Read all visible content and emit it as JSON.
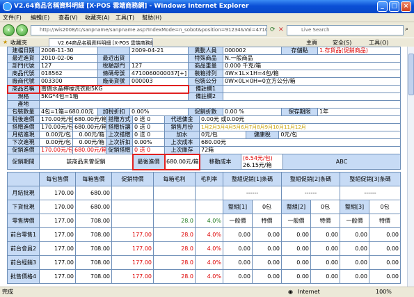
{
  "window": {
    "title": "V2.64商品名稱資料明細 [X-POS 雲端商務網] - Windows Internet Explorer"
  },
  "menu": [
    "文件(F)",
    "編輯(E)",
    "查看(V)",
    "收藏夾(A)",
    "工具(T)",
    "幫助(H)"
  ],
  "address": {
    "url": "http://wis2008/tc/sanpname/sanpname.asp?IndexMode=n_sobot&position=91234&Val=471006000000",
    "search_placeholder": "Live Search"
  },
  "favorites": {
    "label": "收藏夾",
    "tab": "V2.64商品名稱資料明細 [X-POS 雲端商務網]",
    "tools": [
      "主頁",
      "安全(S)",
      "工具(O)"
    ]
  },
  "top_rows": [
    {
      "l1": "建檔日期",
      "v1": "2008-11-30",
      "l2": "",
      "v2": "2009-04-21",
      "l3": "異動人員",
      "v3": "000002",
      "l4": "存儲點",
      "v4": "1.存貨品(促銷商品)"
    },
    {
      "l1": "最近進貨",
      "v1": "2010-02-06",
      "l2": "最近出貨",
      "v2": "",
      "l3": "特殊商品",
      "v3": "N.一般商品"
    },
    {
      "l1": "部門代號",
      "v1": "127",
      "l2": "稅額部門",
      "v2": "127",
      "l3": "商品重量",
      "v3": "0.000 千克/箱"
    },
    {
      "l1": "商品代號",
      "v1": "018562",
      "l2": "條碼母號",
      "v2": "4710060000037[+]",
      "l3": "裝箱排列",
      "v3": "4W×1L×1H=4包/箱"
    },
    {
      "l1": "廠商代號",
      "v1": "003300",
      "l2": "廠商貨號",
      "v2": "000003",
      "l3": "包裝公分",
      "v3": "0W×0L×0H=0立方公分/箱"
    }
  ],
  "product": {
    "name_label": "商品名稱",
    "name": "南僑水晶檸檬洗衣粉5KG",
    "spec_label": "規格",
    "spec": "5KG*4包=1箱",
    "origin_label": "產地",
    "note1": "備註欄1",
    "note2": "備註欄2"
  },
  "rows": [
    {
      "l1": "包裝數量",
      "v1": "4包=1箱=680.00元",
      "l2": "加稅折扣",
      "v2": "0.00%",
      "l3": "促銷折數",
      "v3": "0.00 %",
      "l4": "保存期限",
      "v4": "1年"
    },
    {
      "l1": "稅後進價",
      "v1a": "170.00元/包",
      "v1b": "680.00元/箱",
      "l2": "搭贈方式",
      "v2": "0 送 0",
      "l3": "代送傭金",
      "v3": "0.00元 或0.00元"
    },
    {
      "l1": "搭贈進價",
      "v1a": "170.00元/包",
      "v1b": "680.00元/箱",
      "l2": "搭贈折讓",
      "v2": "0 送 0",
      "l3": "銷售月份",
      "v3": "1月2月3月4月5月6月7月8月9月10月11月12月"
    },
    {
      "l1": "月結進現",
      "v1a": "0.00元/包",
      "v1b": "0.00元/箱",
      "l2": "上次搭贈",
      "v2": "0 送 0",
      "l3": "加水",
      "v3": "0元/包",
      "l4": "健康稅",
      "v4": "0元/包"
    },
    {
      "l1": "下次進現",
      "v1a": "0.00元/包",
      "v1b": "0.00元/箱",
      "l2": "上次折扣",
      "v2": "0.00%",
      "l3": "上次成本",
      "v3": "680.00元"
    },
    {
      "l1": "促銷進價",
      "v1a": "170.00元/包",
      "v1b": "680.00元/箱",
      "l2": "促銷搭贈",
      "v2": "0 送 0",
      "l3": "上次庫存",
      "v3": "72箱"
    }
  ],
  "promo": {
    "label": "促銷期間",
    "text": "該商品未曾促銷",
    "last_label": "最後進價",
    "last": "680.00元/箱",
    "move_label": "移動成本",
    "move1": "(6.54元/包)",
    "move2": "26.15元/箱",
    "abc": "ABC"
  },
  "grid": {
    "headers": [
      "",
      "每包售價",
      "每箱售價",
      "促銷特價",
      "每箱毛利",
      "毛利率",
      "整組促銷[1]条碼",
      "整組促銷[2]条碼",
      "整組促銷[3]条碼"
    ],
    "rows": [
      {
        "label": "月結批現",
        "c1": "170.00",
        "c2": "680.00",
        "c3": "",
        "c4": "",
        "c5": "",
        "g1": "------",
        "g2": "------",
        "g3": "------"
      },
      {
        "label": "下貨批現",
        "c1": "170.00",
        "c2": "680.00",
        "c3": "",
        "c4": "",
        "c5": "",
        "g1": "整組[1]",
        "g1b": "0包",
        "g2": "整組[2]",
        "g2b": "0包",
        "g3": "整組[3]",
        "g3b": "0包"
      },
      {
        "label": "零售牌價",
        "c1": "177.00",
        "c2": "708.00",
        "c3": "",
        "c4": "28.0",
        "c5": "4.0%",
        "g1": "一般價",
        "g1b": "特價",
        "g2": "一般價",
        "g2b": "特價",
        "g3": "一般價",
        "g3b": "特價"
      },
      {
        "label": "前台零售1",
        "c1": "177.00",
        "c2": "708.00",
        "c3": "177.00",
        "c4": "28.0",
        "c5": "4.0%",
        "g1": "0.00",
        "g1b": "0.00",
        "g2": "0.00",
        "g2b": "0.00",
        "g3": "0.00",
        "g3b": "0.00"
      },
      {
        "label": "前台會員2",
        "c1": "177.00",
        "c2": "708.00",
        "c3": "177.00",
        "c4": "28.0",
        "c5": "4.0%",
        "g1": "0.00",
        "g1b": "0.00",
        "g2": "0.00",
        "g2b": "0.00",
        "g3": "0.00",
        "g3b": "0.00"
      },
      {
        "label": "前台經銷3",
        "c1": "177.00",
        "c2": "708.00",
        "c3": "177.00",
        "c4": "28.0",
        "c5": "4.0%",
        "g1": "0.00",
        "g1b": "0.00",
        "g2": "0.00",
        "g2b": "0.00",
        "g3": "0.00",
        "g3b": "0.00"
      },
      {
        "label": "批售價格4",
        "c1": "177.00",
        "c2": "708.00",
        "c3": "177.00",
        "c4": "28.0",
        "c5": "4.0%",
        "g1": "0.00",
        "g1b": "0.00",
        "g2": "0.00",
        "g2b": "0.00",
        "g3": "0.00",
        "g3b": "0.00"
      }
    ]
  },
  "status": {
    "left": "完成",
    "zone": "Internet",
    "zoom": "100%"
  }
}
